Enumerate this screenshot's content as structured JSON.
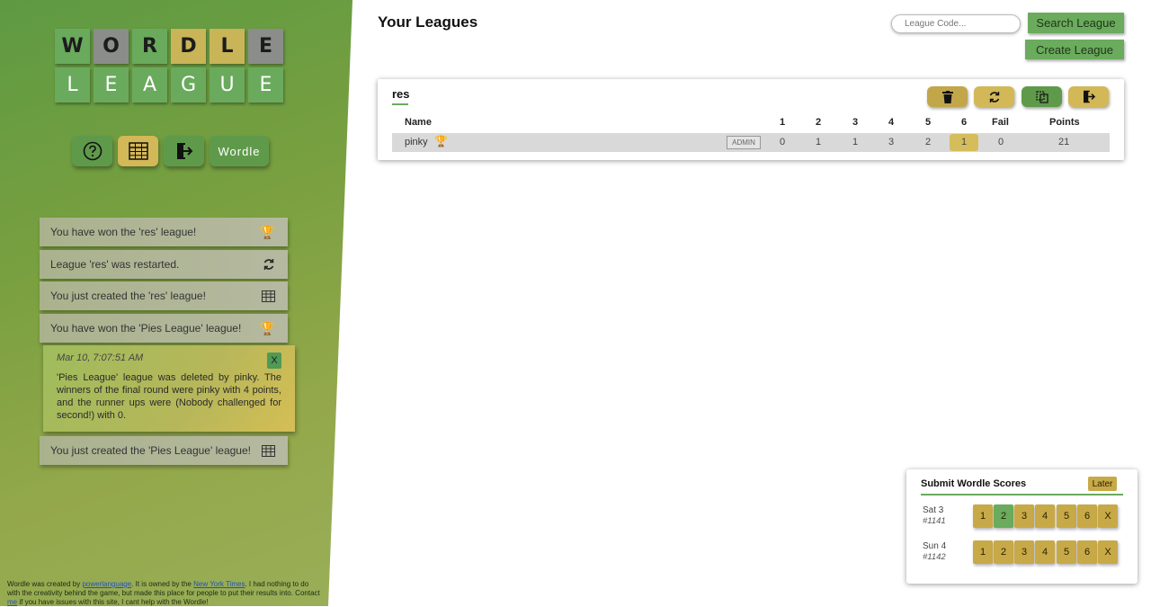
{
  "logo": {
    "row1": [
      {
        "letter": "W",
        "color": "green"
      },
      {
        "letter": "O",
        "color": "gray"
      },
      {
        "letter": "R",
        "color": "green"
      },
      {
        "letter": "D",
        "color": "yellow"
      },
      {
        "letter": "L",
        "color": "yellow"
      },
      {
        "letter": "E",
        "color": "gray"
      }
    ],
    "row2": [
      {
        "letter": "L",
        "color": "green"
      },
      {
        "letter": "E",
        "color": "green"
      },
      {
        "letter": "A",
        "color": "green"
      },
      {
        "letter": "G",
        "color": "green"
      },
      {
        "letter": "U",
        "color": "green"
      },
      {
        "letter": "E",
        "color": "green"
      }
    ]
  },
  "nav": {
    "help_icon": "question-circle-icon",
    "table_icon": "table-grid-icon",
    "logout_icon": "logout-icon",
    "wordle_label": "Wordle"
  },
  "notifications": [
    {
      "text": "You have won the 'res' league!",
      "icon": "trophy-icon"
    },
    {
      "text": "League 'res' was restarted.",
      "icon": "restart-icon"
    },
    {
      "text": "You just created the 'res' league!",
      "icon": "table-grid-icon"
    },
    {
      "text": "You have won the 'Pies League' league!",
      "icon": "trophy-icon"
    }
  ],
  "open_notification": {
    "time": "Mar 10, 7:07:51 AM",
    "message": "'Pies League' league was deleted by pinky. The winners of the final round were pinky with 4 points, and the runner ups were (Nobody challenged for second!) with 0.",
    "close_label": "X"
  },
  "last_notification": {
    "text": "You just created the 'Pies League' league!",
    "icon": "table-grid-icon"
  },
  "footer": {
    "t1": "Wordle was created by ",
    "link1": "powerlanguage",
    "t2": ". It is owned by the ",
    "link2": "New York Times",
    "t3": ". I had nothing to do with the creativity behind the game, but made this place for people to put their results into. Contact ",
    "link3": "me",
    "t4": " if you have issues with this site, I cant help with the Wordle!"
  },
  "main": {
    "title": "Your Leagues",
    "league_code_placeholder": "League Code...",
    "search_label": "Search League",
    "create_label": "Create League"
  },
  "league": {
    "name": "res",
    "headers": {
      "name": "Name",
      "c1": "1",
      "c2": "2",
      "c3": "3",
      "c4": "4",
      "c5": "5",
      "c6": "6",
      "fail": "Fail",
      "points": "Points"
    },
    "row": {
      "player": "pinky",
      "badge": "ADMIN",
      "c1": "0",
      "c2": "1",
      "c3": "1",
      "c4": "3",
      "c5": "2",
      "c6": "1",
      "fail": "0",
      "points": "21"
    },
    "icons": [
      "trash-icon",
      "restart-icon",
      "copy-icon",
      "leave-icon"
    ]
  },
  "submit": {
    "title": "Submit Wordle Scores",
    "later_label": "Later",
    "days": [
      {
        "day": "Sat 3",
        "number": "#1141",
        "options": [
          "1",
          "2",
          "3",
          "4",
          "5",
          "6",
          "X"
        ],
        "selected": "2"
      },
      {
        "day": "Sun 4",
        "number": "#1142",
        "options": [
          "1",
          "2",
          "3",
          "4",
          "5",
          "6",
          "X"
        ],
        "selected": ""
      }
    ]
  },
  "colors": {
    "green": "#6aaa5c",
    "yellow": "#c9b458",
    "gray": "#8a8d8a"
  }
}
